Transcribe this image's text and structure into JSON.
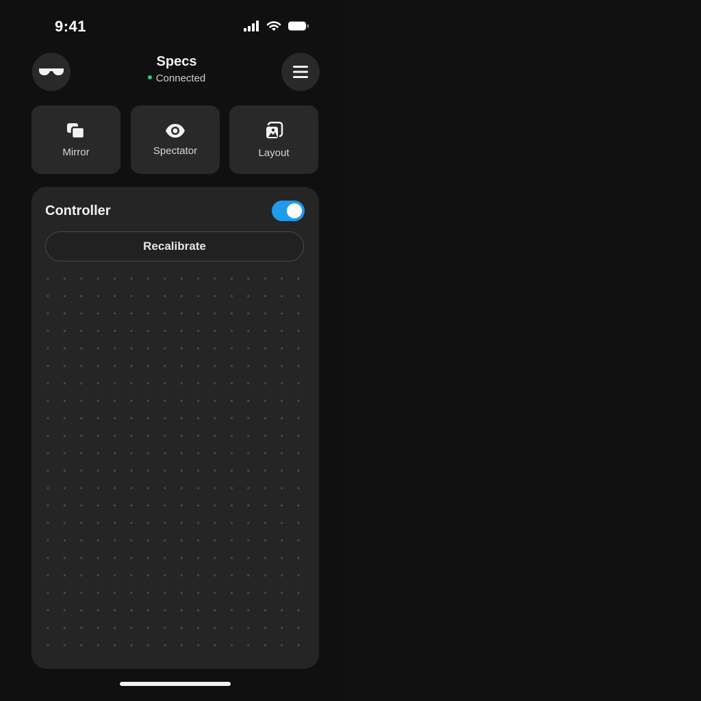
{
  "status_bar": {
    "time": "9:41",
    "icons": [
      "signal-icon",
      "wifi-icon",
      "battery-icon"
    ]
  },
  "header": {
    "device_name": "Specs",
    "connection_status": "Connected",
    "connection_color": "#34c77b",
    "left_icon": "glasses-icon",
    "right_icon": "menu-icon"
  },
  "modes": [
    {
      "label": "Mirror",
      "icon": "mirror-icon"
    },
    {
      "label": "Spectator",
      "icon": "eye-icon"
    },
    {
      "label": "Layout",
      "icon": "layout-icon"
    }
  ],
  "controller": {
    "title": "Controller",
    "enabled": true,
    "toggle_color": "#1e9bea",
    "recalibrate_label": "Recalibrate"
  }
}
